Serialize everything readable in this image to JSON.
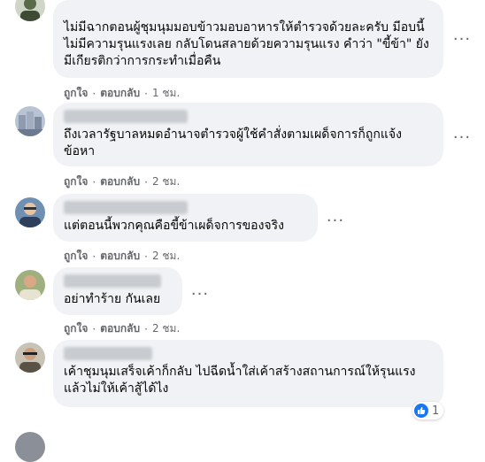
{
  "comments": [
    {
      "text": "ไม่มีฉากตอนผู้ชุมนุมมอบข้าวมอบอาหารให้ตำรวจด้วยละครับ มีอบนี้ไม่มีความรุนแรงเลย กลับโดนสลายด้วยความรุนแรง คำว่า \"ขี้ข้า\" ยังมีเกียรติกว่าการกระทำเมื่อคืน",
      "like": "ถูกใจ",
      "reply": "ตอบกลับ",
      "time": "1 ชม."
    },
    {
      "text": "ถึงเวลารัฐบาลหมดอำนาจตำรวจผู้ใช้คำสั่งตามเผด็จการก็ถูกแจ้งข้อหา",
      "like": "ถูกใจ",
      "reply": "ตอบกลับ",
      "time": "2 ชม."
    },
    {
      "text": "แต่ตอนนี้พวกคุณคือขี้ข้าเผด็จการของจริง",
      "like": "ถูกใจ",
      "reply": "ตอบกลับ",
      "time": "2 ชม."
    },
    {
      "text": "อย่าทำร้าย กันเลย",
      "like": "ถูกใจ",
      "reply": "ตอบกลับ",
      "time": "2 ชม."
    },
    {
      "text": "เค้าชุมนุมเสร็จเค้าก็กลับ ไปฉีดน้ำใส่เค้าสร้างสถานการณ์ให้รุนแรงแล้วไม่ให้เค้าสู้ได้ไง",
      "like": "ถูกใจ",
      "reply": "ตอบกลับ",
      "time": "2 ชม.",
      "reaction_count": "1"
    }
  ],
  "colors": {
    "bubble": "#f0f2f5",
    "secondary_text": "#65676b",
    "like_blue": "#1877f2"
  }
}
